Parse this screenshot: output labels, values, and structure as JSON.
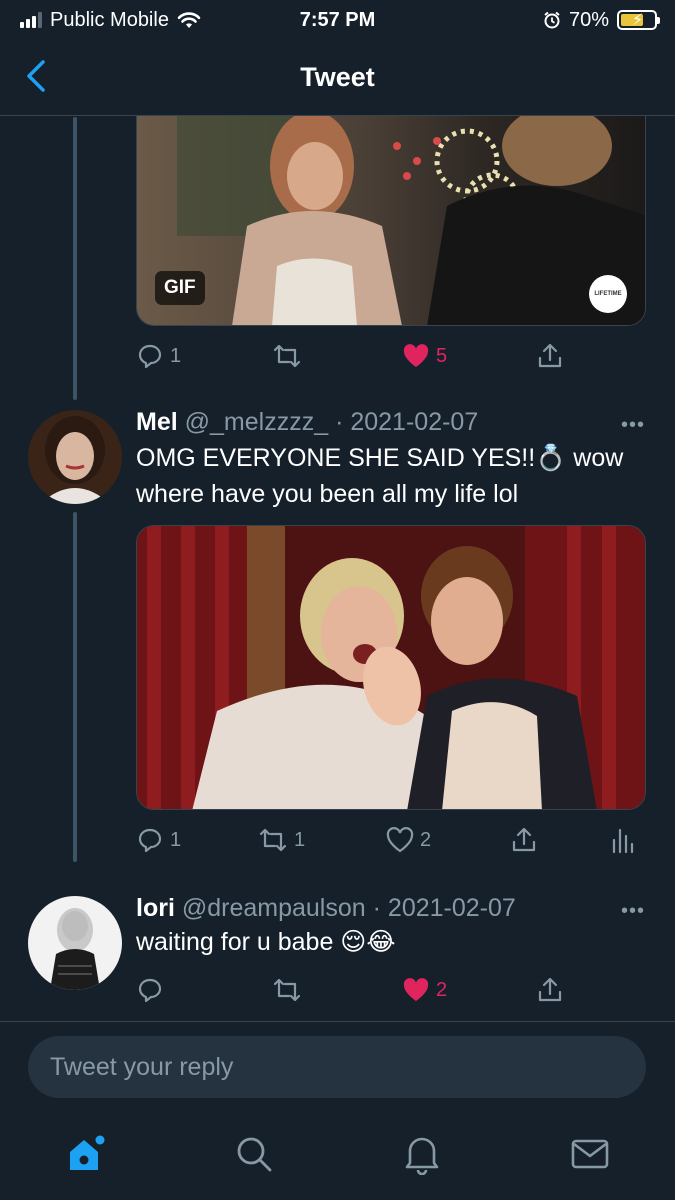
{
  "status": {
    "carrier": "Public Mobile",
    "time": "7:57 PM",
    "battery": "70%",
    "battery_level": 0.7
  },
  "header": {
    "title": "Tweet"
  },
  "tweet_prev": {
    "media": {
      "badge": "GIF",
      "logo": "LIFETIME"
    },
    "actions": {
      "replies": "1",
      "retweets": "",
      "likes": "5",
      "liked": true
    }
  },
  "tweet_mel": {
    "name": "Mel",
    "handle": "@_melzzzz_",
    "date": "· 2021-02-07",
    "text": "OMG EVERYONE SHE SAID YES!!💍 wow where have you been all my life lol",
    "more": "•••",
    "actions": {
      "replies": "1",
      "retweets": "1",
      "likes": "2",
      "liked": false
    }
  },
  "tweet_lori": {
    "name": "lori",
    "handle": "@dreampaulson",
    "date": "· 2021-02-07",
    "text": "waiting for u babe 😌😂",
    "more": "•••",
    "actions": {
      "replies": "",
      "retweets": "",
      "likes": "2",
      "liked": true
    }
  },
  "reply": {
    "placeholder": "Tweet your reply"
  },
  "nav": {
    "items": [
      "home-icon",
      "search-icon",
      "notifications-icon",
      "messages-icon"
    ]
  },
  "colors": {
    "background": "#15202b",
    "accent": "#1da1f2",
    "like": "#e0245e",
    "muted": "#8899a6"
  }
}
